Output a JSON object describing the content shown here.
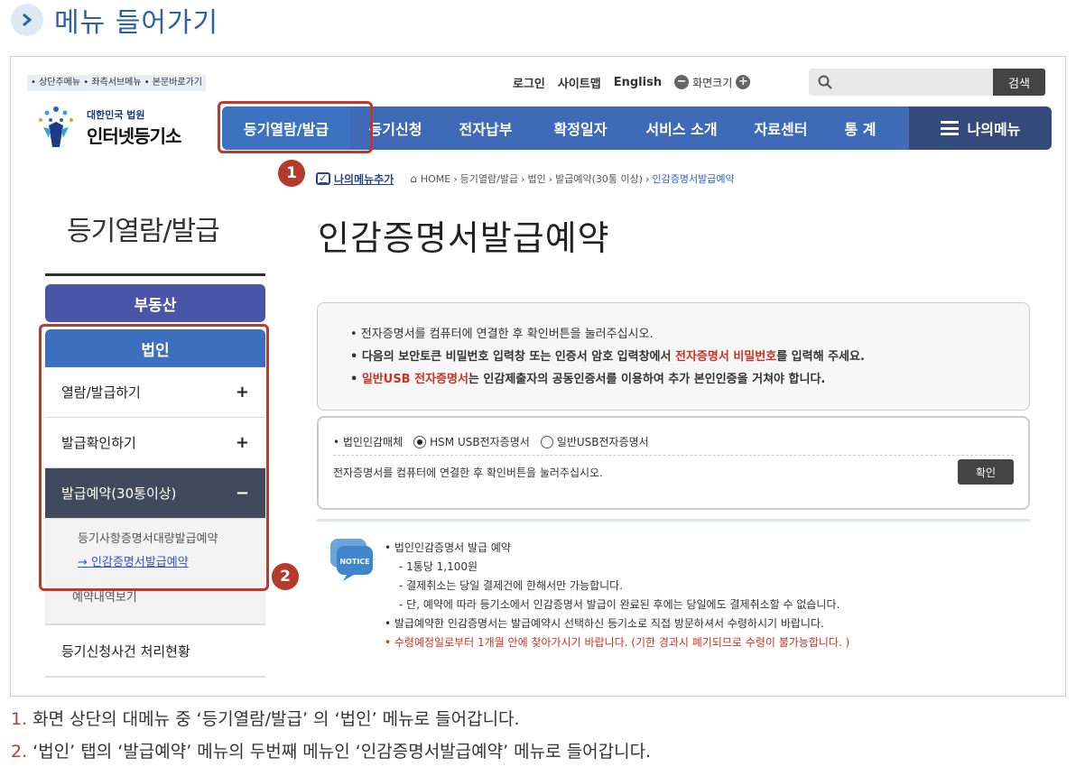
{
  "section": {
    "title": "메뉴 들어가기"
  },
  "header": {
    "skip_links": "• 상단주메뉴 • 좌측서브메뉴 • 본문바로가기",
    "util": {
      "login": "로그인",
      "sitemap": "사이트맵",
      "english": "English",
      "zoom_minus": "−",
      "zoom_label": "화면크기",
      "zoom_plus": "+"
    },
    "search": {
      "placeholder": "",
      "button": "검색"
    },
    "logo": {
      "small": "대한민국 법원",
      "big": "인터넷등기소"
    },
    "gnb": [
      "등기열람/발급",
      "등기신청",
      "전자납부",
      "확정일자",
      "서비스 소개",
      "자료센터",
      "통 계"
    ],
    "my_menu": "나의메뉴"
  },
  "badges": {
    "one": "1",
    "two": "2"
  },
  "breadcrumb": {
    "add_menu": "나의메뉴추가",
    "items": [
      "HOME",
      "등기열람/발급",
      "법인",
      "발급예약(30통 이상)"
    ],
    "current": "인감증명서발급예약",
    "sep": "›"
  },
  "sidebar": {
    "title": "등기열람/발급",
    "btn_realestate": "부동산",
    "btn_corp": "법인",
    "rows": [
      {
        "label": "열람/발급하기",
        "mark": "+"
      },
      {
        "label": "발급확인하기",
        "mark": "+"
      },
      {
        "label": "발급예약(30통이상)",
        "mark": "−"
      }
    ],
    "sub": [
      "등기사항증명서대량발급예약",
      "→ 인감증명서발급예약"
    ],
    "sub_tail": "예약내역보기",
    "last": "등기신청사건 처리현황"
  },
  "main": {
    "title": "인감증명서발급예약",
    "notice": {
      "line1": "• 전자증명서를 컴퓨터에 연결한 후 확인버튼을 눌러주십시오.",
      "line2_pre": "• 다음의 보안토큰 비밀번호 입력창 또는 인증서 암호 입력창에서 ",
      "line2_red": "전자증명서 비밀번호",
      "line2_post": "를 입력해 주세요.",
      "line3_pre": "• ",
      "line3_red": "일반USB 전자증명서",
      "line3_post": "는 인감제출자의 공동인증서를 이용하여 추가 본인인증을 거쳐야 합니다."
    },
    "select": {
      "label": "• 법인인감매체",
      "opt1": "HSM USB전자증명서",
      "opt2": "일반USB전자증명서",
      "message": "전자증명서를 컴퓨터에 연결한 후 확인버튼을 눌러주십시오.",
      "confirm": "확인"
    },
    "info": {
      "icon_label": "NOTICE",
      "l1": "• 법인인감증명서 발급 예약",
      "l2": "- 1통당 1,100원",
      "l3": "- 결제취소는 당일 결제건에 한해서만 가능합니다.",
      "l4": "- 단, 예약에 따라 등기소에서 인감증명서 발급이 완료된 후에는 당일에도 결제취소할 수 없습니다.",
      "l5": "• 발급예약한 인감증명서는 발급예약시 선택하신 등기소로 직접 방문하셔서 수령하시기 바랍니다.",
      "l6": "• 수령예정일로부터 1개월 안에 찾아가시기 바랍니다. (기한 경과시 폐기되므로 수령이 불가능합니다. )"
    }
  },
  "captions": [
    {
      "num": "1.",
      "text": " 화면 상단의 대메뉴 중 ‘등기열람/발급’ 의 ‘법인’ 메뉴로 들어갑니다."
    },
    {
      "num": "2.",
      "text": " ‘법인’ 탭의 ‘발급예약’ 메뉴의 두번째 메뉴인 ‘인감증명서발급예약’ 메뉴로 들어갑니다."
    }
  ],
  "colors": {
    "accent": "#c0392b",
    "nav": "#3e6ab7",
    "nav_dark": "#344a7a",
    "title_blue": "#2b62a3"
  }
}
